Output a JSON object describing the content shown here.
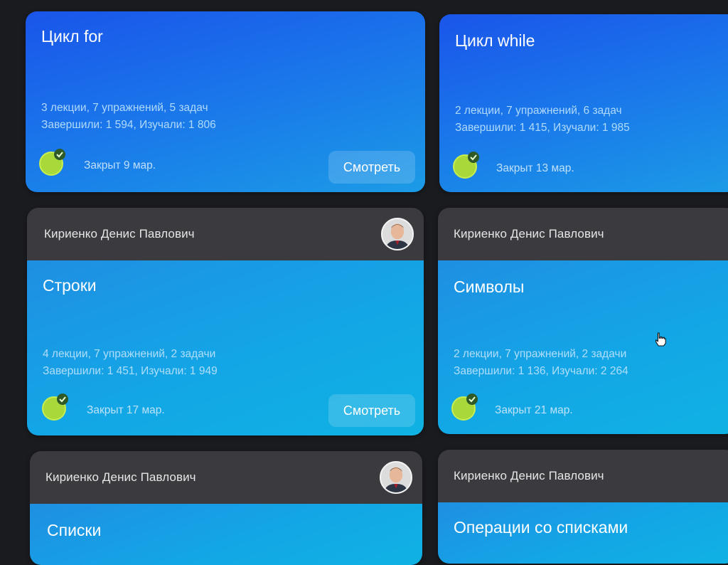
{
  "cards": [
    {
      "title": "Цикл for",
      "meta_line1": "3 лекции, 7 упражнений, 5 задач",
      "meta_line2": "Завершили: 1 594, Изучали: 1 806",
      "closed": "Закрыт 9 мар.",
      "button": "Смотреть"
    },
    {
      "title": "Цикл while",
      "meta_line1": "2 лекции, 7 упражнений, 6 задач",
      "meta_line2": "Завершили: 1 415, Изучали: 1 985",
      "closed": "Закрыт 13 мар."
    },
    {
      "author": "Кириенко Денис Павлович",
      "title": "Строки",
      "meta_line1": "4 лекции, 7 упражнений, 2 задачи",
      "meta_line2": "Завершили: 1 451, Изучали: 1 949",
      "closed": "Закрыт 17 мар.",
      "button": "Смотреть"
    },
    {
      "author": "Кириенко Денис Павлович",
      "title": "Символы",
      "meta_line1": "2 лекции, 7 упражнений, 2 задачи",
      "meta_line2": "Завершили: 1 136, Изучали: 2 264",
      "closed": "Закрыт 21 мар."
    },
    {
      "author": "Кириенко Денис Павлович",
      "title": "Списки"
    },
    {
      "author": "Кириенко Денис Павлович",
      "title": "Операции со списками"
    }
  ],
  "colors": {
    "page_bg": "#1a1b1f",
    "header_bg": "#3a3a3f",
    "badge_green": "#a8d83a",
    "check_bg": "#2f5a28"
  },
  "icons": {
    "badge": "completed-check-badge-icon",
    "avatar": "author-avatar",
    "cursor": "hand-pointer-icon"
  }
}
